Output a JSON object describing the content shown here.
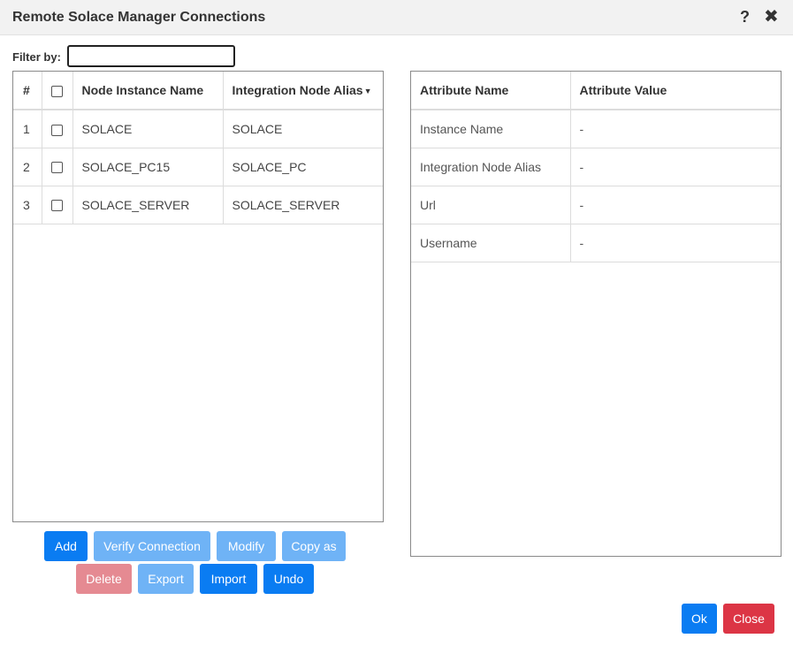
{
  "dialog": {
    "title": "Remote Solace Manager Connections",
    "help_glyph": "?",
    "close_glyph": "✖"
  },
  "filter": {
    "label": "Filter by:",
    "value": ""
  },
  "connections_table": {
    "headers": {
      "num": "#",
      "node_instance_name": "Node Instance Name",
      "integration_node_alias": "Integration Node Alias",
      "sort_glyph": "▼"
    },
    "rows": [
      {
        "num": "1",
        "name": "SOLACE",
        "alias": "SOLACE",
        "checked": false
      },
      {
        "num": "2",
        "name": "SOLACE_PC15",
        "alias": "SOLACE_PC",
        "checked": false
      },
      {
        "num": "3",
        "name": "SOLACE_SERVER",
        "alias": "SOLACE_SERVER",
        "checked": false
      }
    ]
  },
  "attributes_table": {
    "headers": {
      "name": "Attribute Name",
      "value": "Attribute Value"
    },
    "rows": [
      {
        "name": "Instance Name",
        "value": "-"
      },
      {
        "name": "Integration Node Alias",
        "value": "-"
      },
      {
        "name": "Url",
        "value": "-"
      },
      {
        "name": "Username",
        "value": "-"
      }
    ]
  },
  "actions": {
    "add": "Add",
    "verify": "Verify Connection",
    "modify": "Modify",
    "copy_as": "Copy as",
    "delete": "Delete",
    "export": "Export",
    "import": "Import",
    "undo": "Undo"
  },
  "footer": {
    "ok": "Ok",
    "close": "Close"
  },
  "colors": {
    "primary": "#0a7cf2",
    "primary_disabled": "#6fb3f6",
    "danger": "#dc3545",
    "danger_disabled": "#e58a92"
  }
}
